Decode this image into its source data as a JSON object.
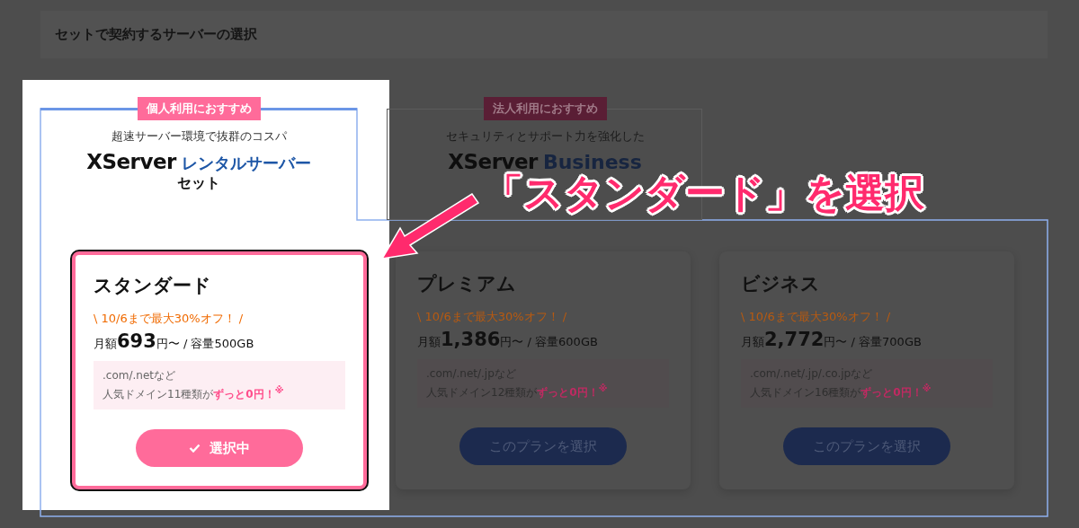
{
  "header": {
    "title": "セットで契約するサーバーの選択"
  },
  "sets": [
    {
      "badge": "個人利用におすすめ",
      "tagline": "超速サーバー環境で抜群のコスパ",
      "brand": "XServer",
      "product": "レンタルサーバー",
      "suffix": "セット",
      "selected": true
    },
    {
      "badge": "法人利用におすすめ",
      "tagline": "セキュリティとサポート力を強化した",
      "brand": "XServer",
      "product": "Business",
      "selected": false
    }
  ],
  "plans": [
    {
      "name": "スタンダード",
      "promo": "\\ 10/6まで最大30%オフ！ /",
      "price_prefix": "月額",
      "price": "693",
      "price_suffix": "円〜 / 容量500GB",
      "domains": ".com/.netなど",
      "domain_note": "人気ドメイン11種類が**ずっと0円！**$^{※}$",
      "button": "選択中",
      "selected": true
    },
    {
      "name": "プレミアム",
      "promo": "\\ 10/6まで最大30%オフ！ /",
      "price_prefix": "月額",
      "price": "1,386",
      "price_suffix": "円〜 / 容量600GB",
      "domains": ".com/.net/.jpなど",
      "domain_note": "人気ドメイン12種類が**ずっと0円！**$^{※}$",
      "button": "このプランを選択",
      "selected": false
    },
    {
      "name": "ビジネス",
      "promo": "\\ 10/6まで最大30%オフ！ /",
      "price_prefix": "月額",
      "price": "2,772",
      "price_suffix": "円〜 / 容量700GB",
      "domains": ".com/.net/.jp/.co.jpなど",
      "domain_note": "人気ドメイン16種類が**ずっと0円！**$^{※}$",
      "button": "このプランを選択",
      "selected": false
    }
  ],
  "callout": "「スタンダード」を選択"
}
